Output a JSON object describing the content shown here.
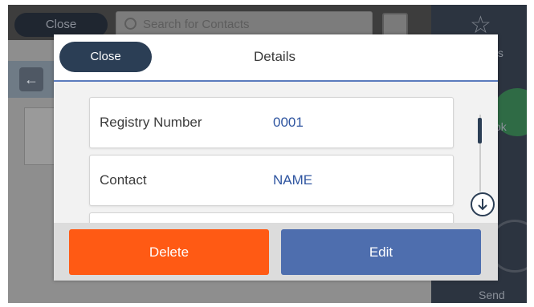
{
  "background": {
    "close_label": "Close",
    "search_placeholder": "Search for Contacts",
    "right_panel_label_top": "ts",
    "right_panel_label_mid": "ok",
    "right_panel_label_bottom": "Send"
  },
  "dialog": {
    "title": "Details",
    "close_label": "Close",
    "rows": [
      {
        "label": "Registry Number",
        "value": "0001"
      },
      {
        "label": "Contact",
        "value": "NAME"
      },
      {
        "label": "",
        "value": ""
      }
    ],
    "delete_label": "Delete",
    "edit_label": "Edit"
  },
  "colors": {
    "accent": "#2b3e55",
    "delete": "#ff5a14",
    "edit": "#4e6eae",
    "value_text": "#2f55a0"
  },
  "icons": {
    "search": "search-icon",
    "address_book": "address-book-icon",
    "back": "back-arrow-icon",
    "favorite": "star-icon",
    "scroll_down": "arrow-down-circle-icon"
  }
}
